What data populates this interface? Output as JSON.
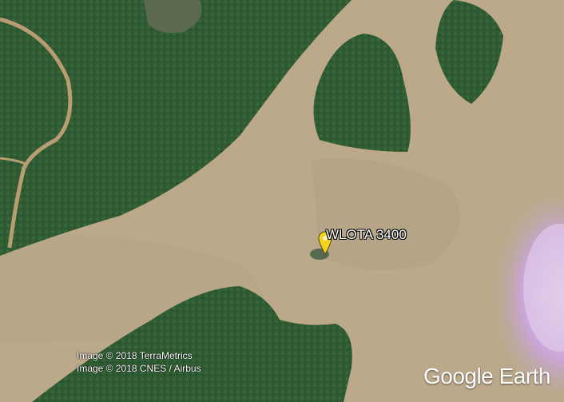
{
  "map": {
    "placemark": {
      "label": "WLOTA 3400",
      "icon": "yellow-pushpin-icon",
      "color": "#f4d31f"
    },
    "attribution": [
      "Image © 2018 TerraMetrics",
      "Image © 2018 CNES / Airbus"
    ],
    "logo": "Google Earth",
    "colors": {
      "water": "#b9a98a",
      "forest": "#2f5c33",
      "road": "#b89c72",
      "cloud": "#c9a6d8"
    }
  }
}
